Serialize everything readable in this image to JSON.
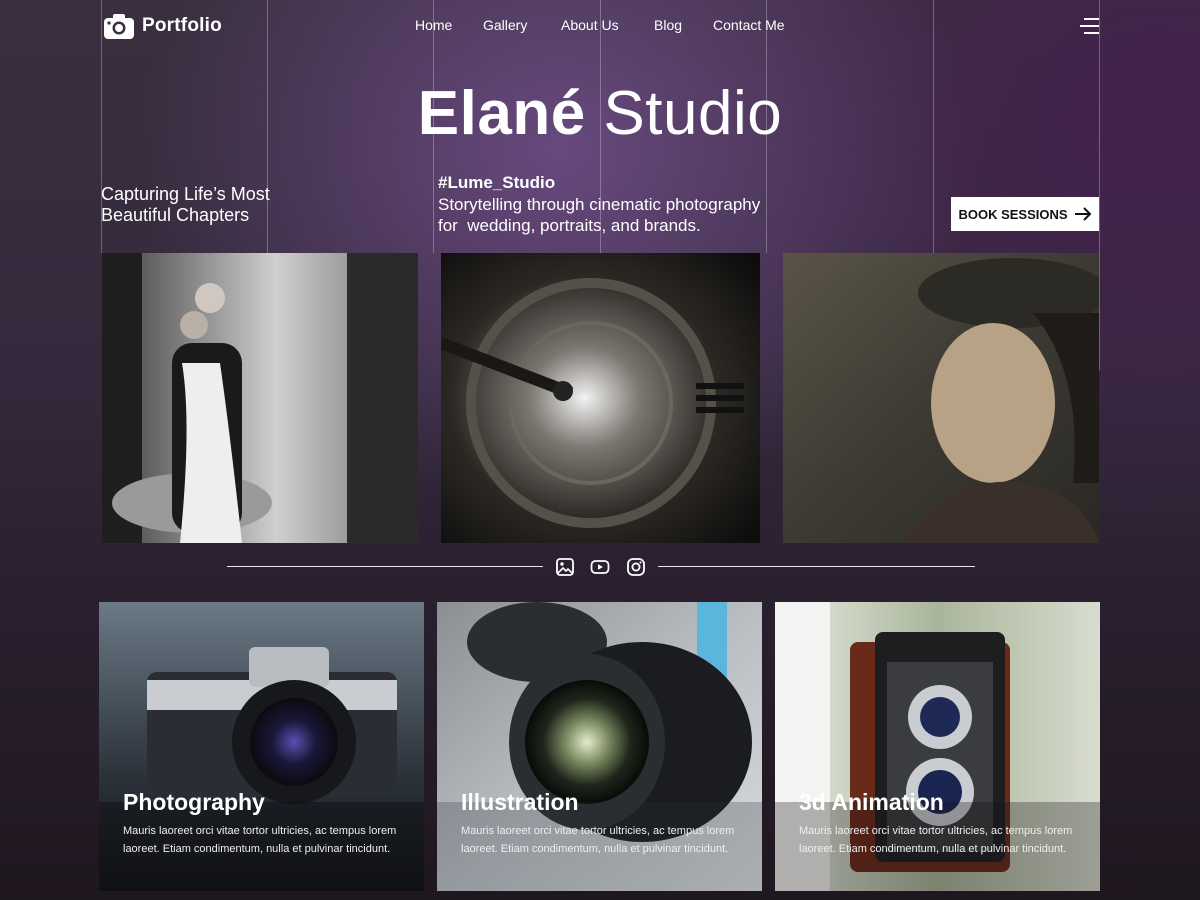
{
  "brand": {
    "name": "Portfolio",
    "icon": "camera-icon"
  },
  "nav": [
    "Home",
    "Gallery",
    "About Us",
    "Blog",
    "Contact Me"
  ],
  "hero": {
    "title_bold": "Elané",
    "title_rest": " Studio",
    "tagline_line1": "Capturing Life’s Most",
    "tagline_line2": "Beautiful Chapters",
    "studio_tag": "#Lume_Studio",
    "studio_desc_line1": "Storytelling through cinematic photography",
    "studio_desc_line2": "for  wedding, portraits, and brands.",
    "cta_label": "BOOK SESSIONS"
  },
  "social_icons": [
    "image-icon",
    "youtube-icon",
    "instagram-icon"
  ],
  "cards": [
    {
      "title": "Photography",
      "desc": "Mauris laoreet orci vitae tortor ultricies, ac tempus lorem laoreet. Etiam condimentum, nulla et pulvinar tincidunt."
    },
    {
      "title": "Illustration",
      "desc": "Mauris laoreet orci vitae tortor ultricies, ac tempus lorem laoreet. Etiam condimentum, nulla et pulvinar tincidunt."
    },
    {
      "title": "3d Animation",
      "desc": "Mauris laoreet orci vitae tortor ultricies, ac tempus lorem laoreet. Etiam condimentum, nulla et pulvinar tincidunt."
    }
  ],
  "colors": {
    "cta_bg": "#ffffff",
    "cta_text": "#111111",
    "text": "#ffffff"
  }
}
